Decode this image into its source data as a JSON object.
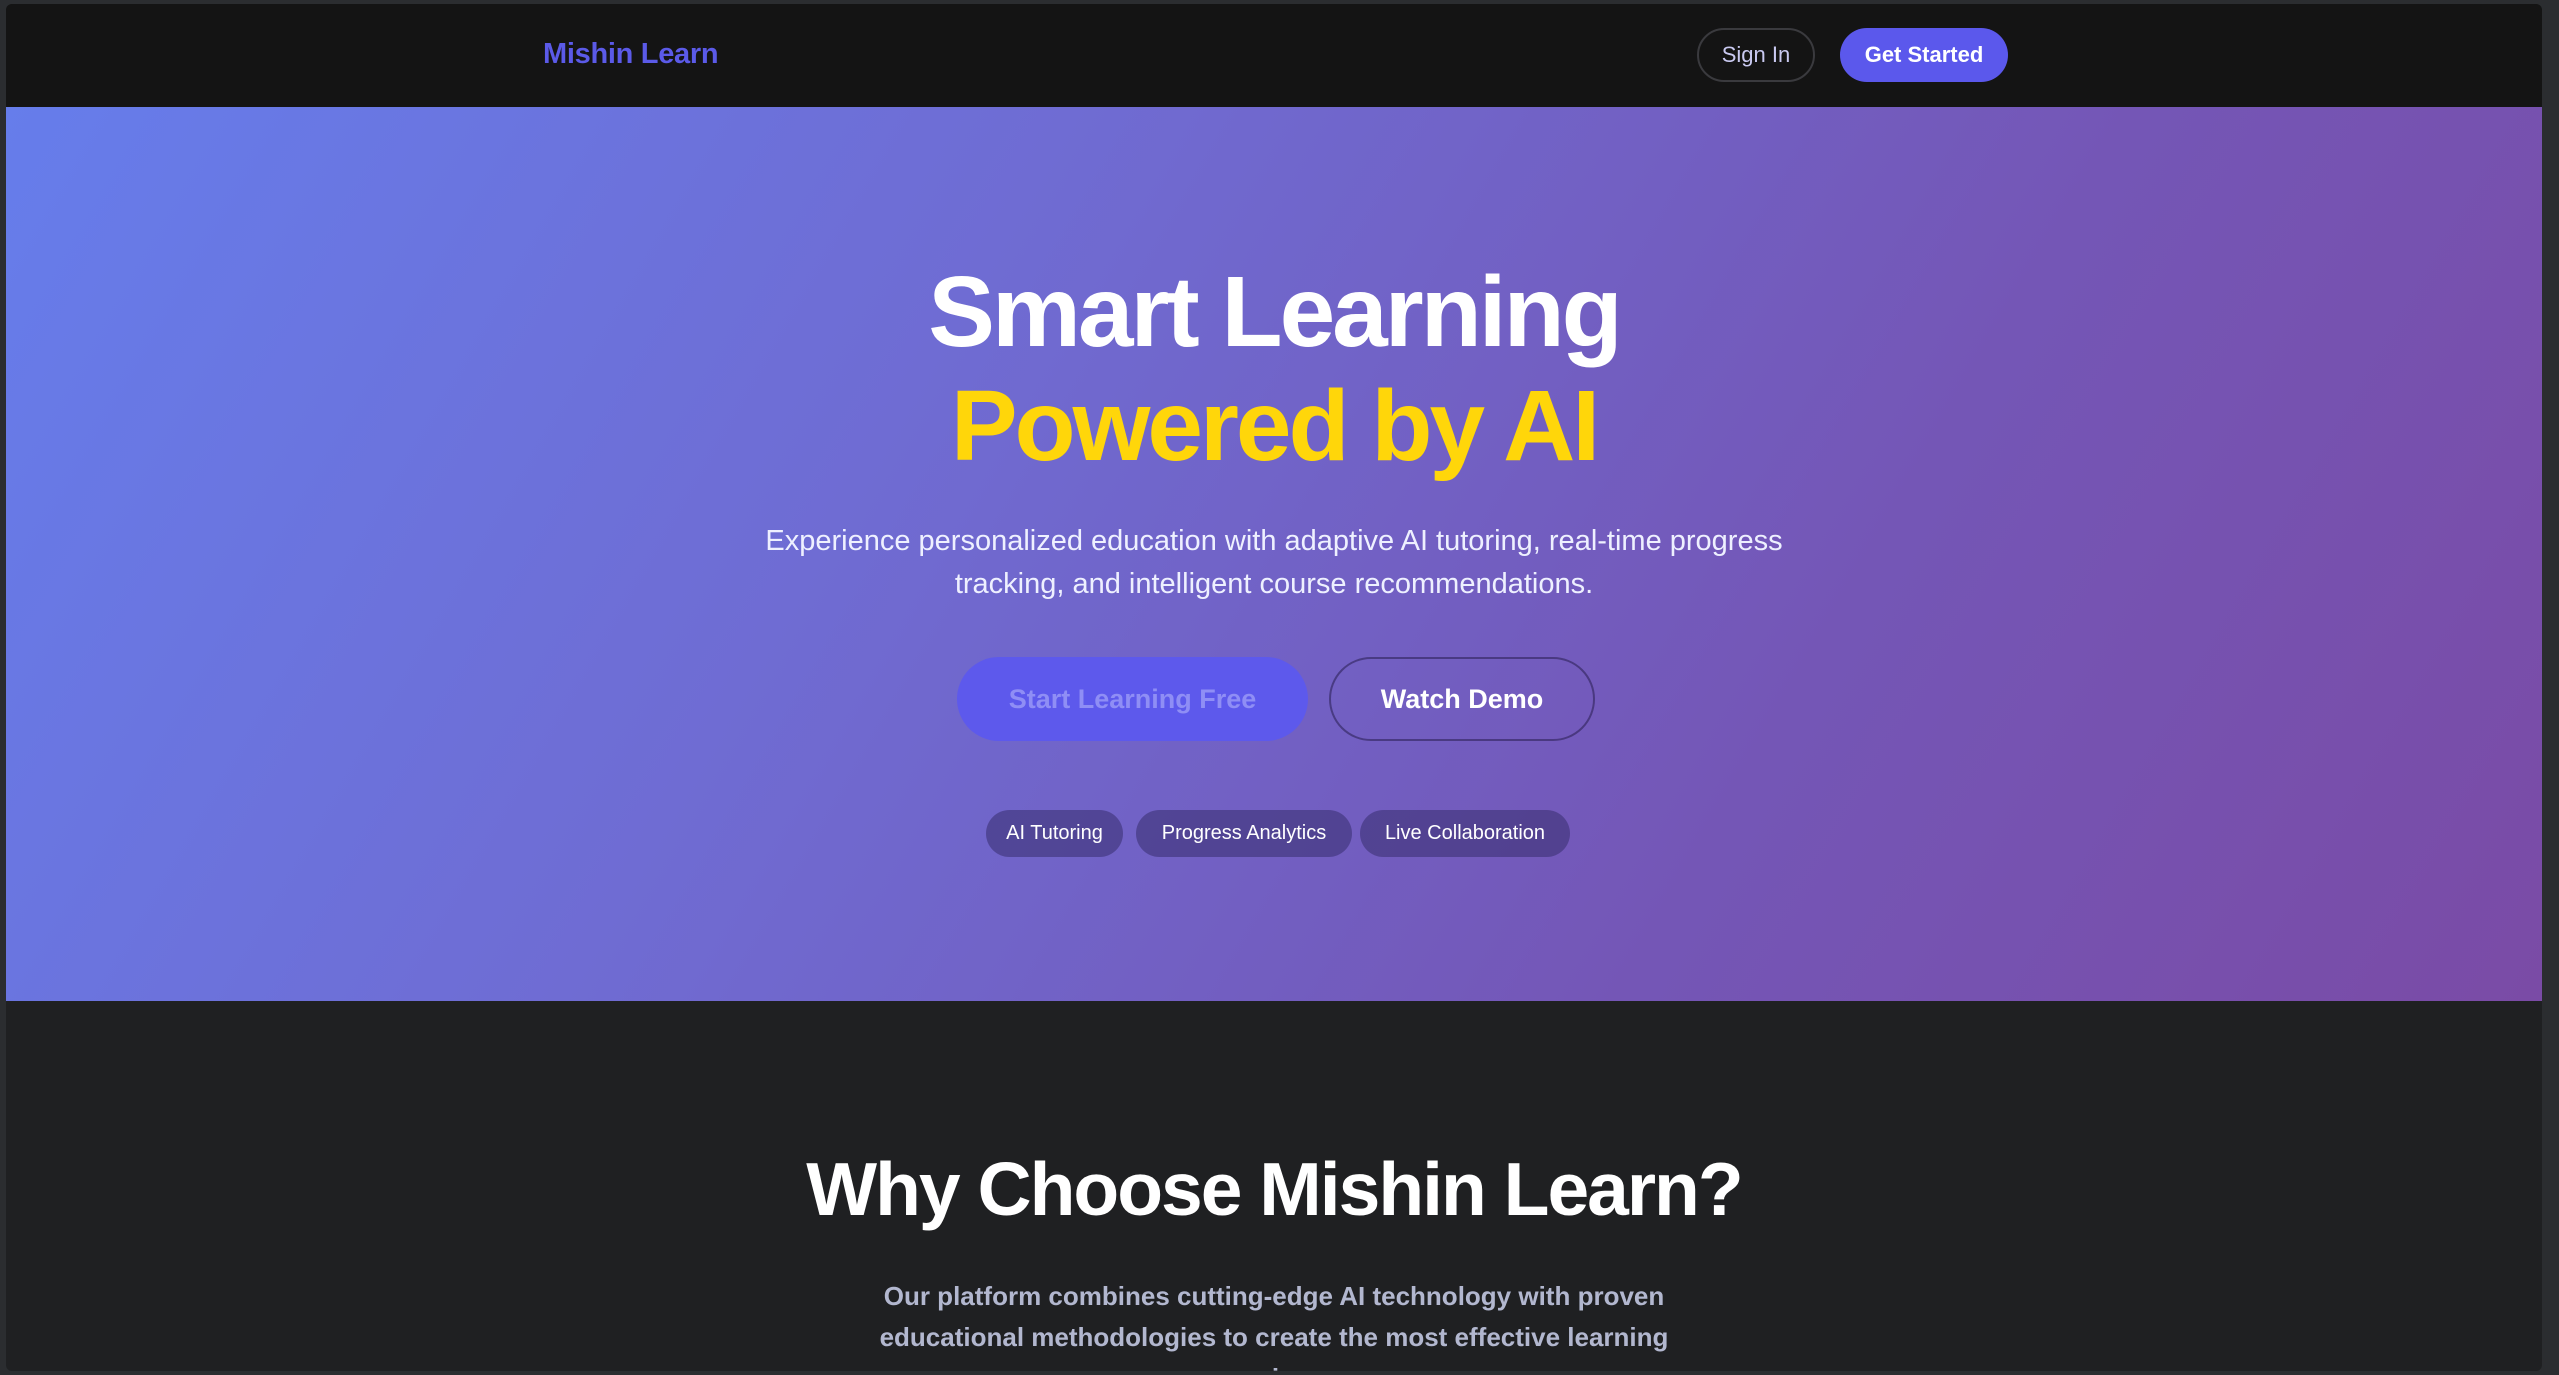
{
  "navbar": {
    "brand": "Mishin Learn",
    "sign_in": "Sign In",
    "get_started": "Get Started"
  },
  "hero": {
    "title_line1": "Smart Learning",
    "title_line2": "Powered by AI",
    "subtitle": "Experience personalized education with adaptive AI tutoring, real-time progress tracking, and intelligent course recommendations.",
    "primary_cta": "Start Learning Free",
    "secondary_cta": "Watch Demo",
    "features": [
      "AI Tutoring",
      "Progress Analytics",
      "Live Collaboration"
    ]
  },
  "why": {
    "title": "Why Choose Mishin Learn?",
    "description": "Our platform combines cutting-edge AI technology with proven educational methodologies to create the most effective learning experience."
  },
  "colors": {
    "brand": "#5b5ae8",
    "accent_yellow": "#ffd60a",
    "primary_button": "#5b58ec",
    "navbar_bg": "#141414",
    "section_bg": "#1f2022"
  }
}
